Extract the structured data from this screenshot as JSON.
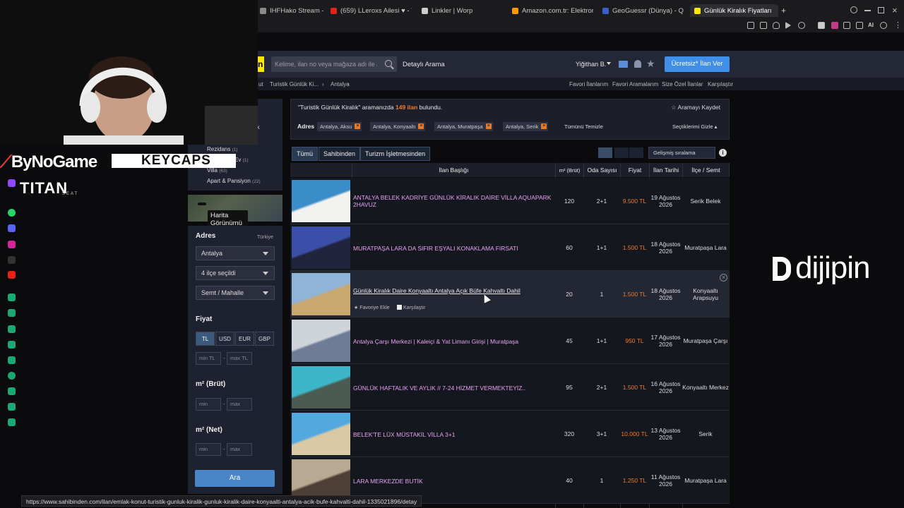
{
  "browser": {
    "tabs": [
      {
        "label": "IHFHako Stream - Wat",
        "color": "#8b8b8b"
      },
      {
        "label": "(659) LLeroxs Ailesi ♥ - Y",
        "color": "#e62117"
      },
      {
        "label": "Linkler | Worp",
        "color": "#cccccc"
      },
      {
        "label": "Amazon.com.tr: Elektronik,",
        "color": "#ff9900"
      },
      {
        "label": "GeoGuessr (Dünya) - Quiz",
        "color": "#3a5fcd"
      },
      {
        "label": "Günlük Kiralık Fiyatları",
        "color": "#ffe800"
      }
    ],
    "status_url": "https://www.sahibinden.com/ilan/emlak-konut-turistik-gunluk-kiralik-gunluk-kiralik-daire-konyaalti-antalya-acik-bufe-kahvalti-dahil-1335021896/detay"
  },
  "header": {
    "logo": "n",
    "search_placeholder": "Kelime, ilan no veya mağaza adı ile ara",
    "detailed_search": "Detaylı Arama",
    "user": "Yiğithan B.",
    "cta": "Ücretsiz* İlan Ver"
  },
  "breadcrumb": {
    "a": "ut",
    "b": "Turistik Günlük Ki...",
    "c": "Antalya"
  },
  "subnav": [
    "Favori İlanlarım",
    "Favori Aramalarım",
    "Size Özel İlanlar",
    "Karşılaştır"
  ],
  "left": {
    "cat_partial": "alık",
    "cats": [
      {
        "label": "Rezidans",
        "count": "(1)"
      },
      {
        "label": "Ev",
        "count": "(1)"
      },
      {
        "label": "Villa",
        "count": "(63)"
      },
      {
        "label": "Apart & Pansiyon",
        "count": "(22)"
      }
    ],
    "map_button": "Harita Görünümü",
    "adres_title": "Adres",
    "country": "Türkiye",
    "city": "Antalya",
    "district": "4 ilçe seçildi",
    "neighborhood": "Semt / Mahalle",
    "fiyat_title": "Fiyat",
    "currencies": [
      "TL",
      "USD",
      "EUR",
      "GBP"
    ],
    "min_tl": "min TL",
    "max_tl": "max TL",
    "m2_brut_title": "m² (Brüt)",
    "m2_net_title": "m² (Net)",
    "min": "min",
    "max": "max",
    "search_button": "Ara"
  },
  "results": {
    "query": "\"Turistik Günlük Kiralık\" aramanızda",
    "count": "149 ilan",
    "found": "bulundu.",
    "save_search": "Aramayı Kaydet",
    "adres_label": "Adres",
    "chips": [
      "Antalya, Aksu",
      "Antalya, Konyaaltı",
      "Antalya, Muratpaşa",
      "Antalya, Serik"
    ],
    "clear_all": "Tümünü Temizle",
    "hide_selected": "Seçtiklerimi Gizle",
    "tabs": [
      "Tümü",
      "Sahibinden",
      "Turizm İşletmesinden"
    ],
    "sort": "Gelişmiş sıralama",
    "columns": [
      "İlan Başlığı",
      "m² (Brüt)",
      "Oda Sayısı",
      "Fiyat",
      "İlan Tarihi",
      "İlçe / Semt"
    ],
    "listings": [
      {
        "title": "ANTALYA BELEK KADRİYE GÜNLÜK KİRALIK DAİRE VİLLA AQUAPARK 2HAVUZ",
        "m2": "120",
        "rooms": "2+1",
        "price": "9.500 TL",
        "date": "19 Ağustos 2026",
        "loc": "Serik Belek",
        "thumb": [
          "#3a8dc8",
          "#f2f2f0"
        ]
      },
      {
        "title": "MURATPAŞA LARA DA SIFIR EŞYALI KONAKLAMA FIRSATI",
        "m2": "60",
        "rooms": "1+1",
        "price": "1.500 TL",
        "date": "18 Ağustos 2026",
        "loc": "Muratpaşa Lara",
        "thumb": [
          "#3b4fa8",
          "#20243c"
        ]
      },
      {
        "title": "Günlük Kiralık Daire Konyaaltı Antalya Açık Büfe Kahvaltı Dahil",
        "m2": "20",
        "rooms": "1",
        "price": "1.500 TL",
        "date": "18 Ağustos 2026",
        "loc": "Konyaaltı Arapsuyu",
        "thumb": [
          "#8fb4d8",
          "#c9a870"
        ],
        "fav": "Favoriye Ekle",
        "compare": "Karşılaştır"
      },
      {
        "title": "Antalya Çarşı Merkezi | Kaleiçi & Yat Limanı Girişi | Muratpaşa",
        "m2": "45",
        "rooms": "1+1",
        "price": "950 TL",
        "date": "17 Ağustos 2026",
        "loc": "Muratpaşa Çarşı",
        "thumb": [
          "#cfd3da",
          "#6f7c96"
        ]
      },
      {
        "title": "GÜNLÜK HAFTALIK VE AYLIK // 7-24 HİZMET VERMEKTEYİZ..",
        "m2": "95",
        "rooms": "2+1",
        "price": "1.500 TL",
        "date": "16 Ağustos 2026",
        "loc": "Konyaaltı Merkez",
        "thumb": [
          "#3cb6c8",
          "#4b5b52"
        ]
      },
      {
        "title": "BELEK'TE LÜX MÜSTAKİL VİLLA 3+1",
        "m2": "320",
        "rooms": "3+1",
        "price": "10.000 TL",
        "date": "13 Ağustos 2026",
        "loc": "Serik",
        "thumb": [
          "#53a8e0",
          "#d9c9a6"
        ]
      },
      {
        "title": "LARA MERKEZDE BUTİK",
        "m2": "40",
        "rooms": "1",
        "price": "1.250 TL",
        "date": "11 Ağustos 2026",
        "loc": "Muratpaşa Lara",
        "thumb": [
          "#b9a892",
          "#4d3f36"
        ]
      }
    ]
  },
  "overlay": {
    "brand1": "ByNoGame",
    "brand2": "KEYCAPS",
    "brand3": "TITAN",
    "brand3_sub": "SEAT",
    "brand4": "dijipin"
  }
}
